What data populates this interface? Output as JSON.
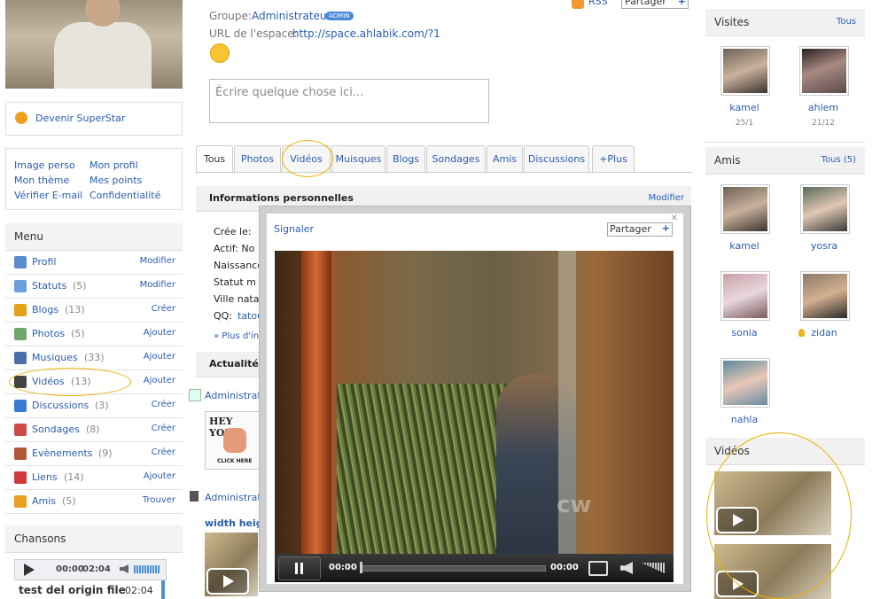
{
  "profile": {
    "group_label": "Groupe:",
    "group_value": "Administrateur",
    "admin_badge": "ADMIN",
    "url_label": "URL de l'espace:",
    "url_value": "http://space.ahlabik.com/?1",
    "rss_label": "RSS",
    "share_label": "Partager",
    "composer_placeholder": "Écrire quelque chose ici..."
  },
  "left": {
    "superstar_label": "Devenir SuperStar",
    "links": [
      "Image perso",
      "Mon profil",
      "Mon thème",
      "Mes points",
      "Vérifier E-mail",
      "Confidentialité"
    ],
    "menu_title": "Menu",
    "menu": [
      {
        "label": "Profil",
        "count": "",
        "action": "Modifier",
        "icon": "profile-icon",
        "color": "#5b8ccf"
      },
      {
        "label": "Statuts",
        "count": "(5)",
        "action": "Modifier",
        "icon": "status-bubble-icon",
        "color": "#6aa0e0"
      },
      {
        "label": "Blogs",
        "count": "(13)",
        "action": "Créer",
        "icon": "blog-icon",
        "color": "#e3a21a"
      },
      {
        "label": "Photos",
        "count": "(5)",
        "action": "Ajouter",
        "icon": "photo-icon",
        "color": "#6fa86a"
      },
      {
        "label": "Musiques",
        "count": "(33)",
        "action": "Ajouter",
        "icon": "headphones-icon",
        "color": "#4a6fa8"
      },
      {
        "label": "Vidéos",
        "count": "(13)",
        "action": "Ajouter",
        "icon": "video-icon",
        "color": "#444444"
      },
      {
        "label": "Discussions",
        "count": "(3)",
        "action": "Créer",
        "icon": "discussion-icon",
        "color": "#3a7bd5"
      },
      {
        "label": "Sondages",
        "count": "(8)",
        "action": "Créer",
        "icon": "poll-icon",
        "color": "#d04a4a"
      },
      {
        "label": "Evènements",
        "count": "(9)",
        "action": "Créer",
        "icon": "calendar-icon",
        "color": "#b0573a"
      },
      {
        "label": "Liens",
        "count": "(14)",
        "action": "Ajouter",
        "icon": "link-hearts-icon",
        "color": "#d03a3a"
      },
      {
        "label": "Amis",
        "count": "(5)",
        "action": "Trouver",
        "icon": "handshake-icon",
        "color": "#e8a020"
      }
    ],
    "songs_title": "Chansons",
    "player_time": "00:00",
    "player_total": "02:04",
    "song_name": "test del origin file",
    "song_duration": "02:04"
  },
  "tabs": [
    "Tous",
    "Photos",
    "Vidéos",
    "Muisques",
    "Blogs",
    "Sondages",
    "Amis",
    "Discussions",
    "+Plus"
  ],
  "info": {
    "title": "Informations personnelles",
    "edit": "Modifier",
    "rows": [
      "Crée le:",
      "Actif:  No",
      "Naissance",
      "Statut m",
      "Ville nata",
      "QQ:"
    ],
    "qq_value": "tatou",
    "more": "» Plus d'inf"
  },
  "news": {
    "title": "Actualités",
    "author1": "Administrate",
    "ad_text": "HEY YOU",
    "ad_sub": "CLICK HERE",
    "author2": "Administrate",
    "video_title": "width heigh"
  },
  "modal": {
    "report": "Signaler",
    "share": "Partager",
    "time_current": "00:00",
    "time_total": "00:00",
    "watermark": "cw"
  },
  "right": {
    "visits_title": "Visites",
    "visits_all": "Tous",
    "visitors": [
      {
        "name": "kamel",
        "date": "25/1"
      },
      {
        "name": "ahlem",
        "date": "21/12"
      }
    ],
    "friends_title": "Amis",
    "friends_all": "Tous (5)",
    "friends": [
      "kamel",
      "yosra",
      "sonia",
      "zidan",
      "nahla"
    ],
    "videos_title": "Vidéos"
  },
  "colors": {
    "link": "#2a5db0",
    "highlight": "#e8b400",
    "admin_badge": "#4a8ad6"
  }
}
